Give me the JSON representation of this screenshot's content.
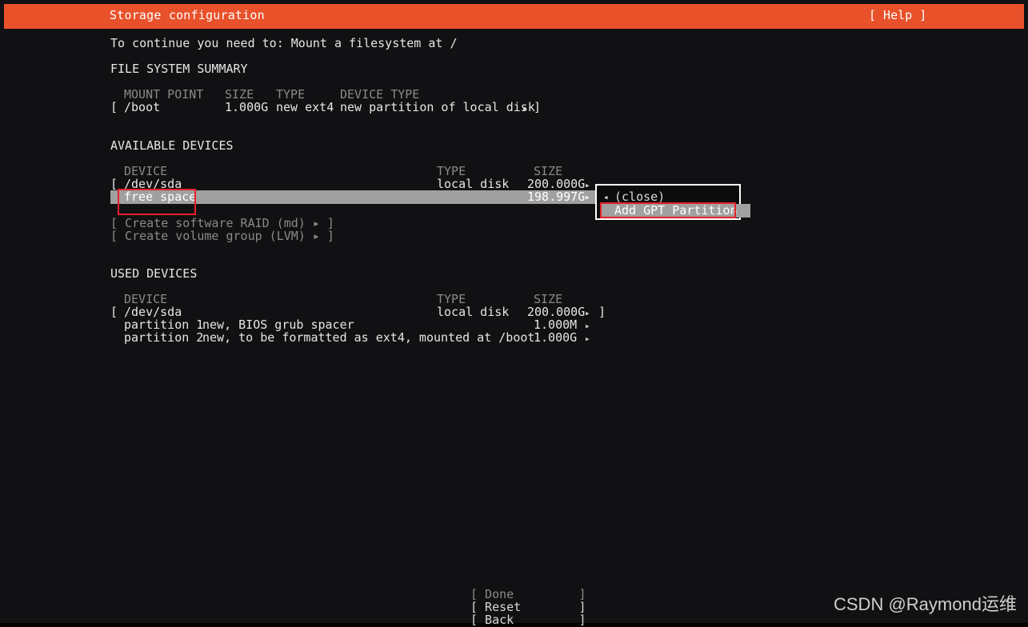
{
  "titlebar": {
    "title": "Storage configuration",
    "help_label": "[ Help ]"
  },
  "notice": "To continue you need to: Mount a filesystem at /",
  "filesystem_summary": {
    "heading": "FILE SYSTEM SUMMARY",
    "columns": {
      "mount_point": "MOUNT POINT",
      "size": "SIZE",
      "type": "TYPE",
      "device_type": "DEVICE TYPE"
    },
    "rows": [
      {
        "open_bracket": "[",
        "mount_point": "/boot",
        "size": "1.000G",
        "type": "new ext4",
        "device_type": "new partition of local disk",
        "arrow": "▸",
        "close_bracket": "]"
      }
    ]
  },
  "available_devices": {
    "heading": "AVAILABLE DEVICES",
    "columns": {
      "device": "DEVICE",
      "type": "TYPE",
      "size": "SIZE"
    },
    "rows": [
      {
        "open_bracket": "[",
        "device": "/dev/sda",
        "type": "local disk",
        "size": "200.000G",
        "arrow": "▸",
        "close_bracket": "]",
        "selected": false
      },
      {
        "open_bracket": "",
        "device": "free space",
        "type": "",
        "size": "198.997G",
        "arrow": "▸",
        "close_bracket": "",
        "selected": true
      }
    ],
    "actions": [
      {
        "label": "[ Create software RAID (md) ▸ ]",
        "enabled": false
      },
      {
        "label": "[ Create volume group (LVM) ▸ ]",
        "enabled": false
      }
    ]
  },
  "popup_menu": {
    "items": [
      {
        "label": "(close)",
        "selected": false,
        "left_arrow": "◂"
      },
      {
        "label": "Add GPT Partition",
        "selected": true,
        "right_arrow": "▸"
      }
    ]
  },
  "used_devices": {
    "heading": "USED DEVICES",
    "columns": {
      "device": "DEVICE",
      "type": "TYPE",
      "size": "SIZE"
    },
    "rows": [
      {
        "open_bracket": "[",
        "device": "/dev/sda",
        "detail": "",
        "type": "local disk",
        "size": "200.000G",
        "arrow": "▸",
        "close_bracket": "]"
      },
      {
        "open_bracket": "",
        "device": "partition 1",
        "detail": "new, BIOS grub spacer",
        "type": "",
        "size": "1.000M",
        "arrow": "▸",
        "close_bracket": ""
      },
      {
        "open_bracket": "",
        "device": "partition 2",
        "detail": "new, to be formatted as ext4, mounted at /boot",
        "type": "",
        "size": "1.000G",
        "arrow": "▸",
        "close_bracket": ""
      }
    ]
  },
  "buttons": [
    {
      "label": "[ Done         ]",
      "enabled": false
    },
    {
      "label": "[ Reset        ]",
      "enabled": true
    },
    {
      "label": "[ Back         ]",
      "enabled": true
    }
  ],
  "watermark": "CSDN @Raymond运维",
  "colors": {
    "accent": "#e8512a",
    "background": "#111113",
    "selection": "#a0a0a0",
    "annotation": "#e8202a",
    "text": "#e6e6e6",
    "dim_text": "#8a8a8a"
  }
}
